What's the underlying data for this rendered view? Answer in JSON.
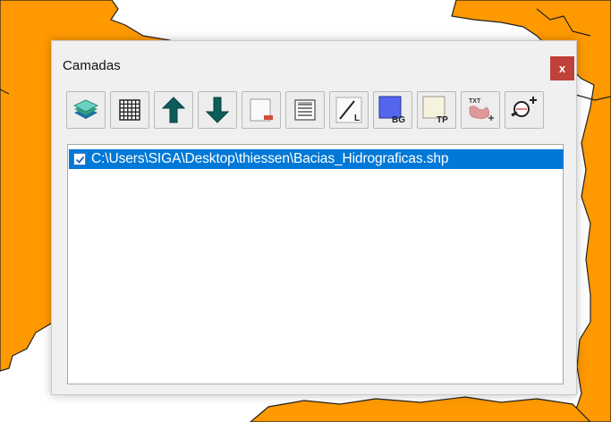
{
  "window": {
    "title": "Camadas",
    "close_label": "x"
  },
  "toolbar": {
    "buttons": [
      {
        "name": "add-layer-button",
        "icon": "layers-icon"
      },
      {
        "name": "attribute-table-button",
        "icon": "grid-table-icon"
      },
      {
        "name": "move-layer-up-button",
        "icon": "arrow-up-icon"
      },
      {
        "name": "move-layer-down-button",
        "icon": "arrow-down-icon"
      },
      {
        "name": "remove-layer-button",
        "icon": "remove-layer-icon"
      },
      {
        "name": "layer-properties-button",
        "icon": "properties-list-icon"
      },
      {
        "name": "line-color-button",
        "icon": "line-style-icon",
        "label": "L"
      },
      {
        "name": "background-color-button",
        "icon": "fill-color-icon",
        "label": "BG"
      },
      {
        "name": "transparency-button",
        "icon": "transparency-icon",
        "label": "TP"
      },
      {
        "name": "label-text-button",
        "icon": "text-label-icon",
        "label": "TXT"
      },
      {
        "name": "zoom-to-layer-button",
        "icon": "zoom-in-icon"
      }
    ]
  },
  "layers": [
    {
      "path": "C:\\Users\\SIGA\\Desktop\\thiessen\\Bacias_Hidrograficas.shp",
      "checked": true,
      "selected": true
    }
  ],
  "colors": {
    "map_fill": "#ff9900",
    "selection": "#0078d7",
    "close_button": "#c0403a",
    "arrow": "#0b5e5a"
  }
}
